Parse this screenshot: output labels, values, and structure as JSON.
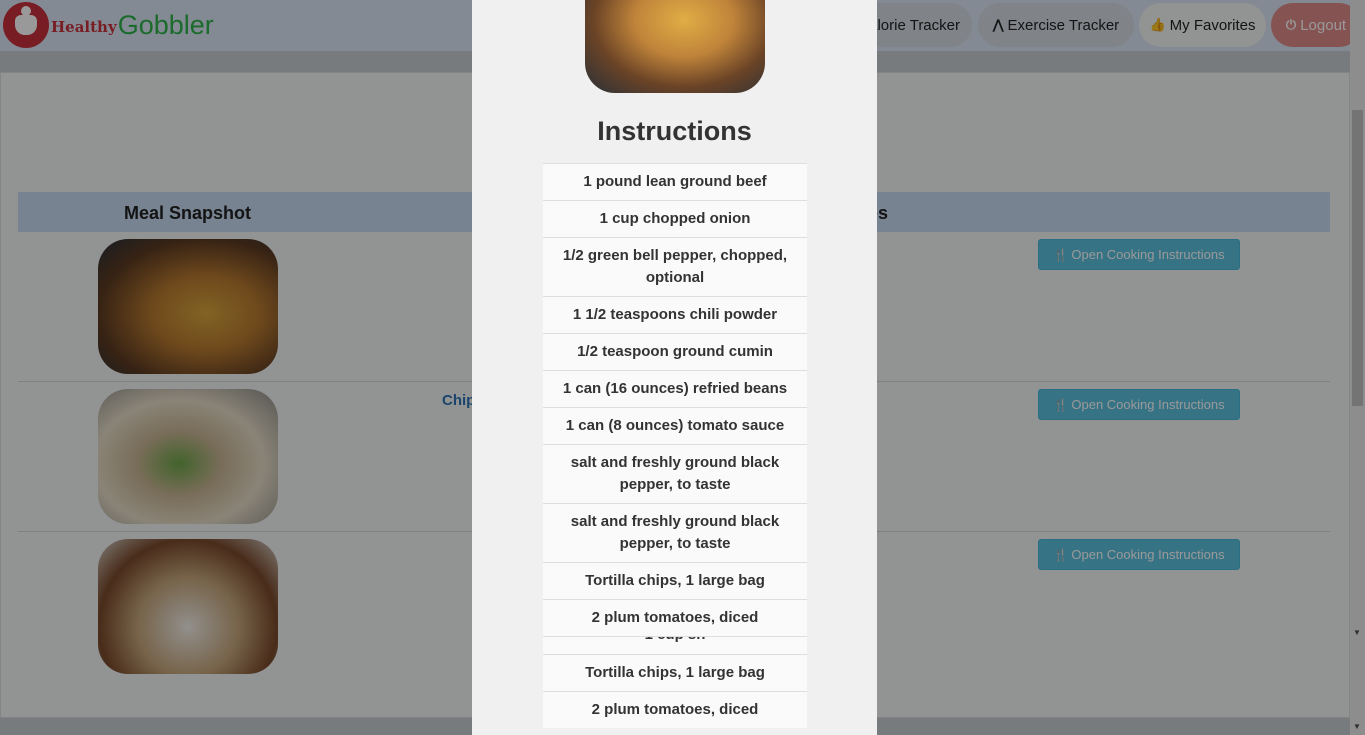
{
  "app": {
    "logo_healthy": "Healthy",
    "logo_gobbler": "Gobbler"
  },
  "nav": {
    "calorie_tracker": "alorie Tracker",
    "exercise_tracker": "Exercise Tracker",
    "my_favorites": "My Favorites",
    "logout": "Logout"
  },
  "table": {
    "col_snapshot": "Meal Snapshot",
    "col_right_fragment": "es",
    "rows": [
      {
        "link_fragment": "",
        "button": "Open Cooking Instructions"
      },
      {
        "link_fragment": "Chip",
        "button": "Open Cooking Instructions"
      },
      {
        "link_fragment": "",
        "button": "Open Cooking Instructions"
      }
    ]
  },
  "modal": {
    "title": "Instructions",
    "ingredients": [
      "1 pound lean ground beef",
      "1 cup chopped onion",
      "1/2 green bell pepper, chopped, optional",
      "1 1/2 teaspoons chili powder",
      "1/2 teaspoon ground cumin",
      "1 can (16 ounces) refried beans",
      "1 can (8 ounces) tomato sauce",
      "salt and freshly ground black pepper, to taste",
      "salt and freshly ground black pepper, to taste",
      "Tortilla chips, 1 large bag",
      "2 plum tomatoes, diced"
    ],
    "partial_item": "1 cup sh",
    "ingredients_repeat": [
      "Tortilla chips, 1 large bag",
      "2 plum tomatoes, diced"
    ]
  },
  "colors": {
    "nav_background": "#dbe6f5",
    "table_header": "#c7daf2",
    "info_button": "#5bc0de",
    "logout_button": "#e08a8a",
    "brand_red": "#c9313b",
    "brand_green": "#2db34a",
    "link": "#2e74b5"
  },
  "icons": {
    "logo": "heart-person-icon",
    "exercise": "road-icon",
    "favorites": "thumbs-up-icon",
    "logout": "power-icon",
    "cooking": "cutlery-icon"
  }
}
